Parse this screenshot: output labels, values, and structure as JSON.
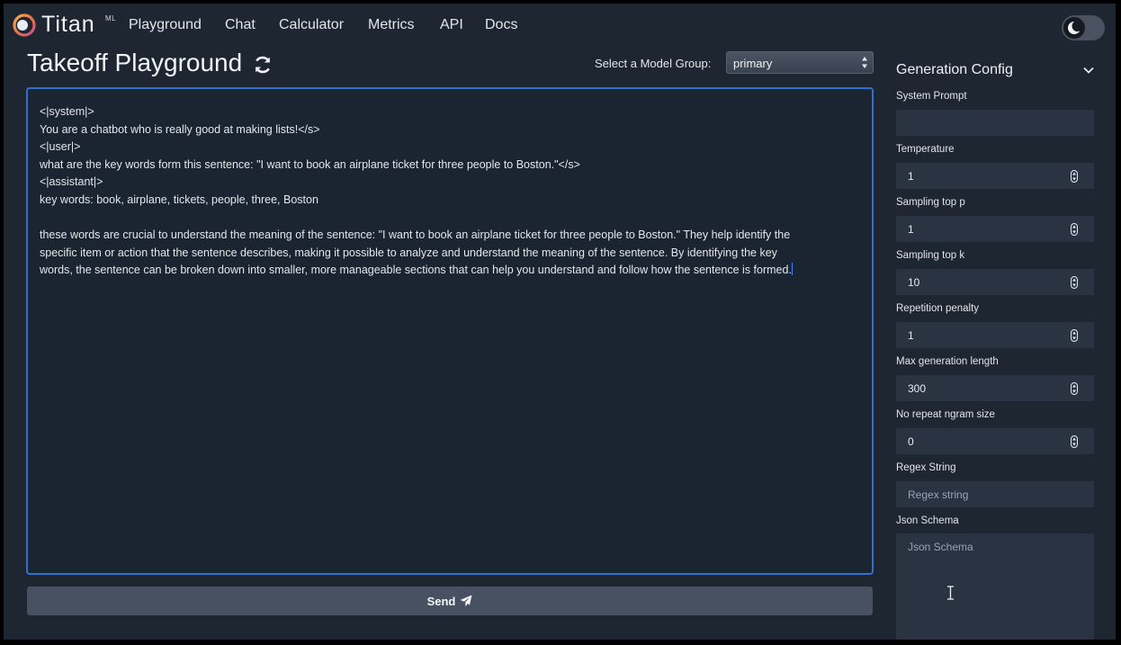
{
  "nav": {
    "brand": "Titan",
    "brand_sup": "ML",
    "links": [
      "Playground",
      "Chat",
      "Calculator",
      "Metrics",
      "API",
      "Docs"
    ]
  },
  "header": {
    "title": "Takeoff Playground",
    "model_group_label": "Select a Model Group:",
    "model_group_value": "primary"
  },
  "editor": {
    "lines": [
      "<|system|>",
      "You are a chatbot who is really good at making lists!</s>",
      "<|user|>",
      "what are the key words form this sentence: \"I want to book an airplane ticket for three people to Boston.\"</s>",
      "<|assistant|>",
      "key words: book, airplane, tickets, people, three, Boston",
      "",
      "these words are crucial to understand the meaning of the sentence: \"I want to book an airplane ticket for three people to Boston.\" They help identify the",
      "specific item or action that the sentence describes, making it possible to analyze and understand the meaning of the sentence. By identifying the key",
      "words, the sentence can be broken down into smaller, more manageable sections that can help you understand and follow how the sentence is formed."
    ]
  },
  "send_label": "Send",
  "config": {
    "title": "Generation Config",
    "system_prompt_label": "System Prompt",
    "system_prompt_value": "",
    "temperature_label": "Temperature",
    "temperature_value": "1",
    "top_p_label": "Sampling top p",
    "top_p_value": "1",
    "top_k_label": "Sampling top k",
    "top_k_value": "10",
    "rep_penalty_label": "Repetition penalty",
    "rep_penalty_value": "1",
    "max_len_label": "Max generation length",
    "max_len_value": "300",
    "ngram_label": "No repeat ngram size",
    "ngram_value": "0",
    "regex_label": "Regex String",
    "regex_placeholder": "Regex string",
    "json_label": "Json Schema",
    "json_placeholder": "Json Schema"
  },
  "colors": {
    "background": "#1e2632",
    "accent": "#2f6fcf",
    "input_bg": "#2a3342",
    "button_bg": "#475161"
  }
}
